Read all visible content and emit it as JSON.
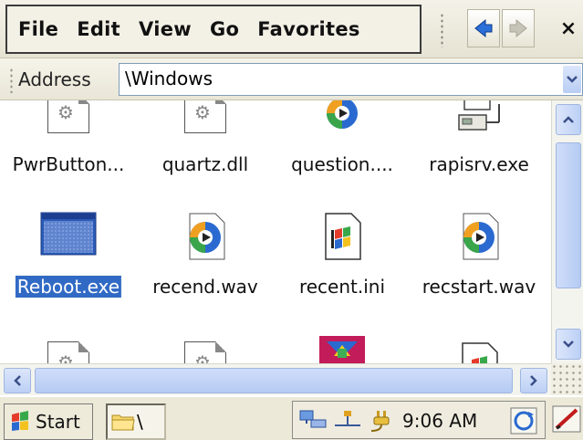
{
  "menu": {
    "items": [
      "File",
      "Edit",
      "View",
      "Go",
      "Favorites"
    ]
  },
  "toolbar": {
    "back_icon": "back-arrow-icon",
    "forward_icon": "forward-arrow-icon",
    "close_label": "×"
  },
  "address": {
    "label": "Address",
    "value": "\\Windows"
  },
  "files": {
    "row1": [
      "PwrButton...",
      "quartz.dll",
      "question....",
      "rapisrv.exe"
    ],
    "row2": [
      "Reboot.exe",
      "recend.wav",
      "recent.ini",
      "recstart.wav"
    ]
  },
  "taskbar": {
    "start_label": "Start",
    "task_label": "\\",
    "time": "9:06 AM"
  },
  "colors": {
    "selection": "#316ac5",
    "scroll": "#bcd0f5"
  }
}
